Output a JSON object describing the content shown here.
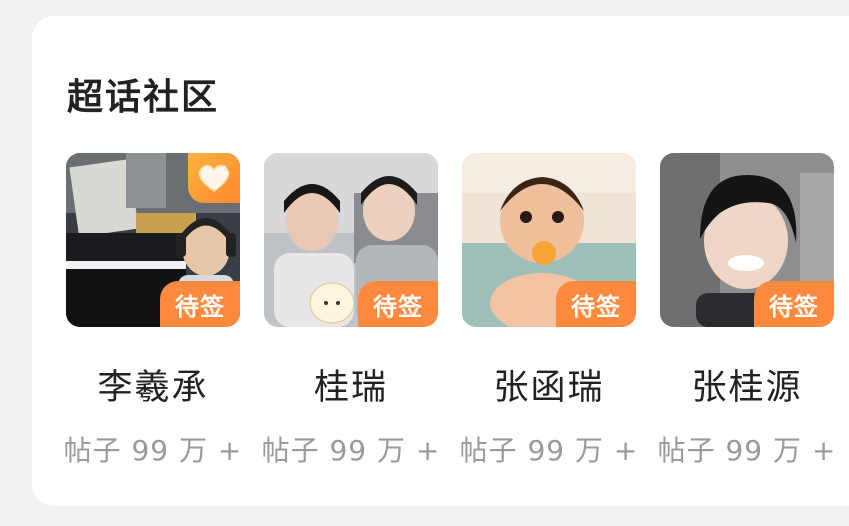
{
  "section": {
    "title": "超话社区"
  },
  "communities": [
    {
      "name": "李羲承",
      "posts": "帖子 99 万 +",
      "badge": "待签",
      "featured_icon": "heart-icon"
    },
    {
      "name": "桂瑞",
      "posts": "帖子 99 万 +",
      "badge": "待签"
    },
    {
      "name": "张函瑞",
      "posts": "帖子 99 万 +",
      "badge": "待签"
    },
    {
      "name": "张桂源",
      "posts": "帖子 99 万 +",
      "badge": "待签"
    }
  ],
  "colors": {
    "badge": "#ff8a3d",
    "card": "#ffffff",
    "background": "#f2f2f5"
  }
}
